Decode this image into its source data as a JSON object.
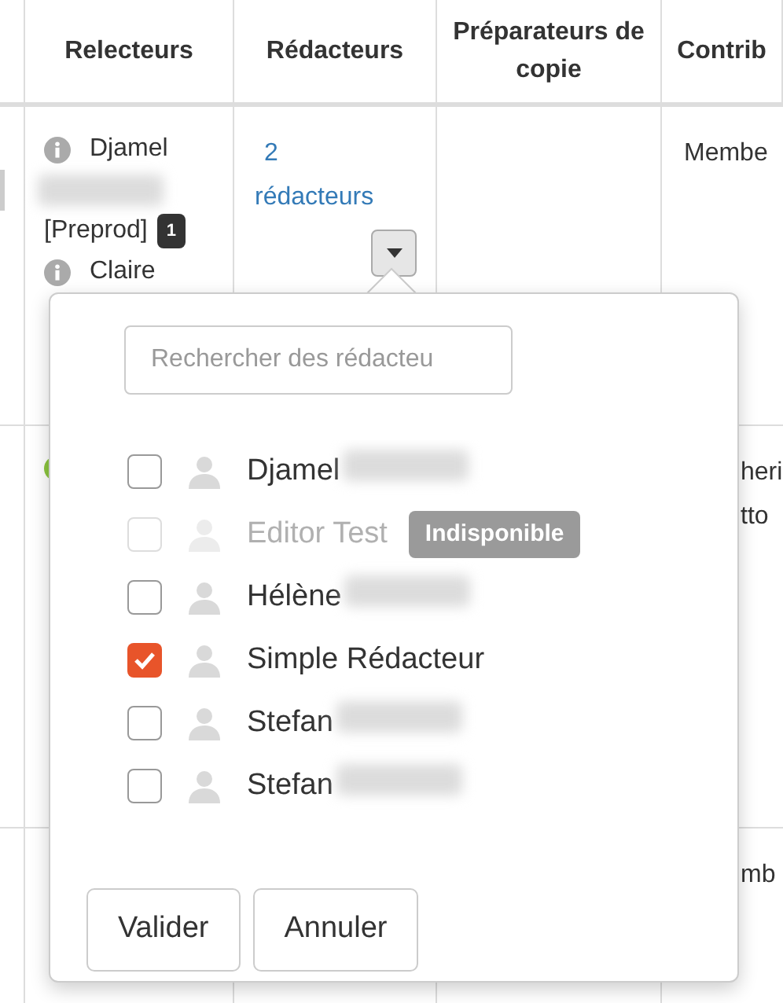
{
  "table": {
    "columns": [
      "Relecteurs",
      "Rédacteurs",
      "Préparateurs de copie",
      "Contrib"
    ],
    "rows": [
      {
        "relecteurs": [
          {
            "kind": "info",
            "text": "Djamel"
          },
          {
            "kind": "redacted"
          },
          {
            "kind": "tag",
            "text": "[Preprod]",
            "badge": "1"
          },
          {
            "kind": "info",
            "text": "Claire"
          }
        ],
        "redacteurs_link": [
          "2",
          "rédacteurs"
        ],
        "contrib": [
          "Membe"
        ]
      },
      {
        "relecteurs": [
          {
            "kind": "dot",
            "color": "#8cc63f"
          }
        ],
        "contrib": [
          "heri",
          "tto"
        ]
      },
      {
        "relecteurs": [],
        "contrib": [
          "mb"
        ]
      }
    ]
  },
  "popover": {
    "search": {
      "placeholder": "Rechercher des rédacteu"
    },
    "items": [
      {
        "name": "Djamel",
        "redacted": true,
        "checked": false,
        "disabled": false
      },
      {
        "name": "Editor Test",
        "redacted": false,
        "checked": false,
        "disabled": true,
        "badge": "Indisponible"
      },
      {
        "name": "Hélène",
        "redacted": true,
        "checked": false,
        "disabled": false
      },
      {
        "name": "Simple Rédacteur",
        "redacted": false,
        "checked": true,
        "disabled": false
      },
      {
        "name": "Stefan",
        "redacted": true,
        "checked": false,
        "disabled": false
      },
      {
        "name": "Stefan",
        "redacted": true,
        "checked": false,
        "disabled": false
      }
    ],
    "buttons": [
      "Valider",
      "Annuler"
    ]
  }
}
